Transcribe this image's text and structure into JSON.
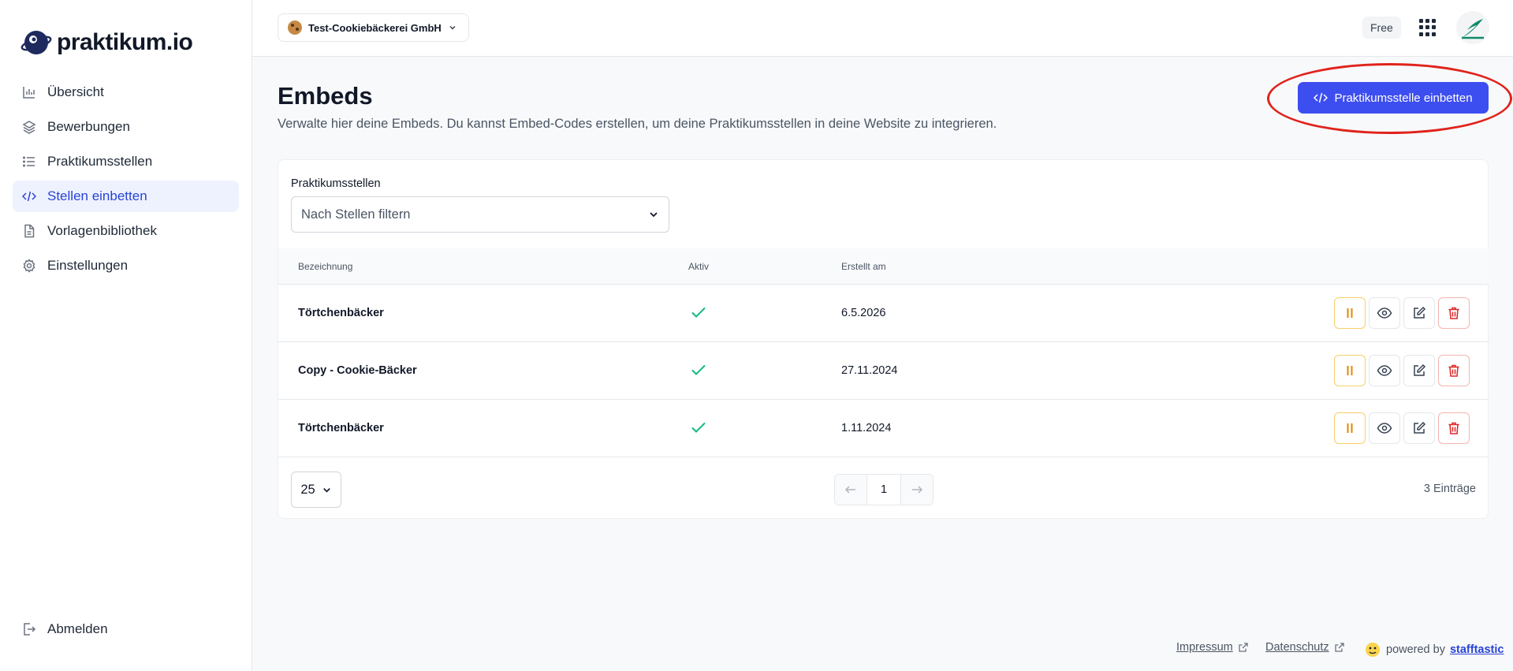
{
  "brand": {
    "name": "praktikum.io"
  },
  "company": {
    "name": "Test-Cookiebäckerei GmbH"
  },
  "topbar": {
    "plan": "Free"
  },
  "nav": {
    "items": [
      {
        "label": "Übersicht",
        "icon": "bar-chart-icon"
      },
      {
        "label": "Bewerbungen",
        "icon": "layers-icon"
      },
      {
        "label": "Praktikumsstellen",
        "icon": "list-icon"
      },
      {
        "label": "Stellen einbetten",
        "icon": "code-icon",
        "active": true
      },
      {
        "label": "Vorlagenbibliothek",
        "icon": "document-icon"
      },
      {
        "label": "Einstellungen",
        "icon": "gear-icon"
      }
    ],
    "logout": "Abmelden"
  },
  "page": {
    "title": "Embeds",
    "description": "Verwalte hier deine Embeds. Du kannst Embed-Codes erstellen, um deine Praktikumsstellen in deine Website zu integrieren.",
    "primary_action": "Praktikumsstelle einbetten"
  },
  "filter": {
    "label": "Praktikumsstellen",
    "placeholder": "Nach Stellen filtern"
  },
  "table": {
    "headers": {
      "name": "Bezeichnung",
      "active": "Aktiv",
      "created": "Erstellt am"
    },
    "rows": [
      {
        "name": "Törtchenbäcker",
        "active": true,
        "created": "6.5.2026"
      },
      {
        "name": "Copy - Cookie-Bäcker",
        "active": true,
        "created": "27.11.2024"
      },
      {
        "name": "Törtchenbäcker",
        "active": true,
        "created": "1.11.2024"
      }
    ]
  },
  "pagination": {
    "per_page": "25",
    "current_page": "1",
    "entries": "3 Einträge"
  },
  "footer": {
    "impressum": "Impressum",
    "datenschutz": "Datenschutz",
    "powered_by": "powered by",
    "powered_brand": "stafftastic"
  },
  "colors": {
    "primary": "#3d4ef0",
    "active_nav": "#2943d6",
    "check": "#10b981",
    "pause": "#e08a00",
    "delete": "#dc2626",
    "highlight": "#e0231b"
  }
}
